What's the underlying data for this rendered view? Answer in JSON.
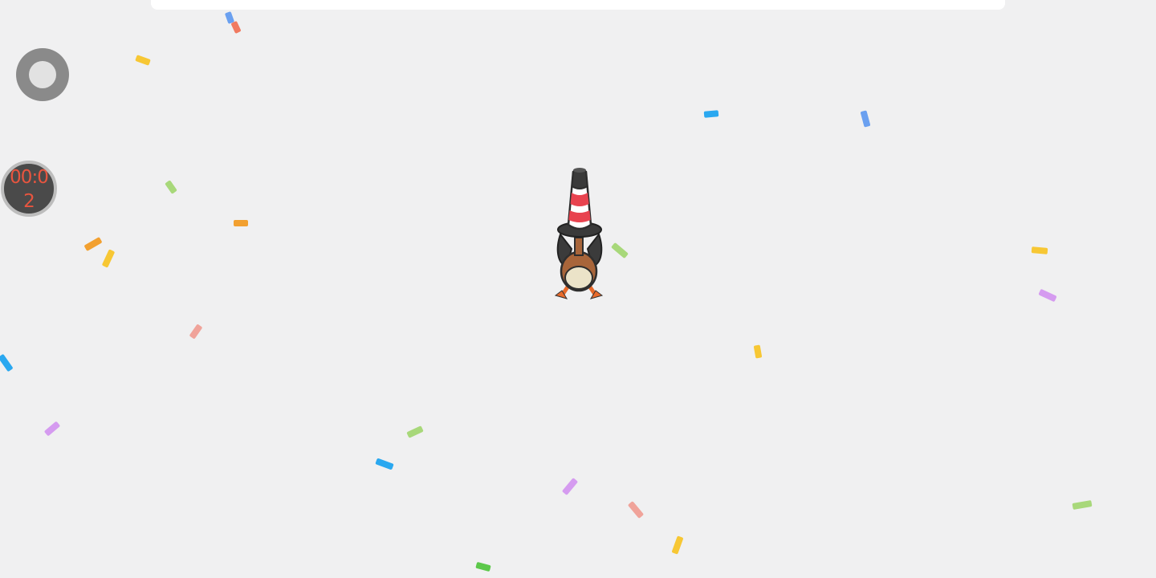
{
  "hud": {
    "timer_text": "00:02"
  },
  "player": {
    "character": "goose-wearing-traffic-cone",
    "cone_colors": {
      "stripe": "#e8434f",
      "base": "#ffffff",
      "tip": "#3a3a3a"
    }
  },
  "confetti_colors": {
    "blue": "#2aa8f0",
    "yellow": "#f7c734",
    "green": "#a8d87a",
    "pink": "#f0a39a",
    "purple": "#d59bf0",
    "orange": "#f2a030",
    "periwinkle": "#6aa0f0",
    "salmon": "#f07a60",
    "leaf": "#5cc84a"
  }
}
